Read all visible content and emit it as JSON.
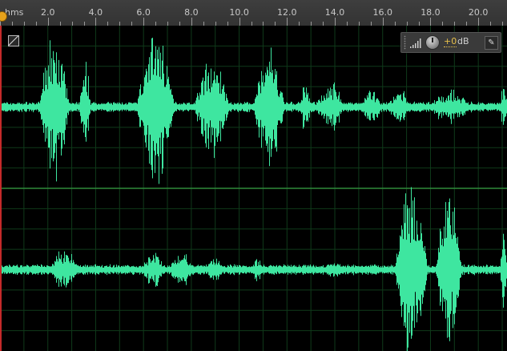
{
  "ruler": {
    "unit_label": "hms",
    "ticks": [
      {
        "label": "2.0",
        "value": 2.0
      },
      {
        "label": "4.0",
        "value": 4.0
      },
      {
        "label": "6.0",
        "value": 6.0
      },
      {
        "label": "8.0",
        "value": 8.0
      },
      {
        "label": "10.0",
        "value": 10.0
      },
      {
        "label": "12.0",
        "value": 12.0
      },
      {
        "label": "14.0",
        "value": 14.0
      },
      {
        "label": "16.0",
        "value": 16.0
      },
      {
        "label": "18.0",
        "value": 18.0
      },
      {
        "label": "20.0",
        "value": 20.0
      }
    ],
    "visible_range_seconds": [
      0.0,
      21.2
    ]
  },
  "playhead": {
    "time_seconds": 0.0,
    "color": "#c52a2a",
    "marker_color": "#e6a21b"
  },
  "hud": {
    "volume_value": "+0",
    "volume_unit": "dB",
    "icons": [
      "level-meter-icon",
      "volume-knob-icon",
      "pin-icon"
    ]
  },
  "waveform": {
    "waveform_color": "#3ee6a0",
    "grid_color": "#0f3a1a",
    "divider_color": "#2f8a3a",
    "channels": [
      {
        "name": "left",
        "bursts": [
          {
            "start": 1.6,
            "end": 2.9,
            "amp": 0.85
          },
          {
            "start": 3.3,
            "end": 3.8,
            "amp": 0.55
          },
          {
            "start": 5.7,
            "end": 7.3,
            "amp": 0.95
          },
          {
            "start": 8.1,
            "end": 9.6,
            "amp": 0.6
          },
          {
            "start": 10.6,
            "end": 11.9,
            "amp": 0.75
          },
          {
            "start": 12.5,
            "end": 13.0,
            "amp": 0.3
          },
          {
            "start": 13.2,
            "end": 14.4,
            "amp": 0.3
          },
          {
            "start": 15.0,
            "end": 16.0,
            "amp": 0.2
          },
          {
            "start": 16.2,
            "end": 17.2,
            "amp": 0.22
          },
          {
            "start": 17.9,
            "end": 19.7,
            "amp": 0.2
          },
          {
            "start": 20.9,
            "end": 21.2,
            "amp": 0.3
          }
        ]
      },
      {
        "name": "right",
        "bursts": [
          {
            "start": 2.0,
            "end": 3.3,
            "amp": 0.25
          },
          {
            "start": 5.9,
            "end": 6.9,
            "amp": 0.22
          },
          {
            "start": 7.0,
            "end": 8.2,
            "amp": 0.2
          },
          {
            "start": 8.5,
            "end": 9.4,
            "amp": 0.15
          },
          {
            "start": 10.5,
            "end": 11.0,
            "amp": 0.15
          },
          {
            "start": 13.5,
            "end": 14.5,
            "amp": 0.1
          },
          {
            "start": 16.5,
            "end": 17.9,
            "amp": 1.0
          },
          {
            "start": 18.2,
            "end": 19.3,
            "amp": 0.95
          },
          {
            "start": 20.9,
            "end": 21.2,
            "amp": 0.55
          }
        ]
      }
    ]
  }
}
